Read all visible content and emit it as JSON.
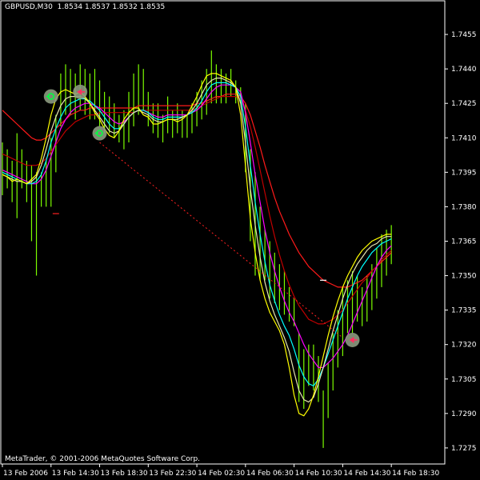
{
  "header": {
    "symbol": "GBPUSD,M30",
    "quote": "1.8534 1.8537 1.8532 1.8535"
  },
  "footer": {
    "copyright": "MetaTrader, © 2001-2006 MetaQuotes Software Corp."
  },
  "chart_data": {
    "type": "line",
    "title": "",
    "background": "#000000",
    "grid": false,
    "ylim": [
      1.7268,
      1.747
    ],
    "xlim": [
      0,
      91
    ],
    "y_ticks": [
      "1.7455",
      "1.7440",
      "1.7425",
      "1.7410",
      "1.7395",
      "1.7380",
      "1.7365",
      "1.7350",
      "1.7335",
      "1.7320",
      "1.7305",
      "1.7290",
      "1.7275"
    ],
    "x_ticks": [
      {
        "label": "13 Feb 2006",
        "index": 0
      },
      {
        "label": "13 Feb 14:30",
        "index": 10
      },
      {
        "label": "13 Feb 18:30",
        "index": 20
      },
      {
        "label": "13 Feb 22:30",
        "index": 30
      },
      {
        "label": "14 Feb 02:30",
        "index": 40
      },
      {
        "label": "14 Feb 06:30",
        "index": 50
      },
      {
        "label": "14 Feb 10:30",
        "index": 60
      },
      {
        "label": "14 Feb 14:30",
        "index": 70
      },
      {
        "label": "14 Feb 18:30",
        "index": 80
      }
    ],
    "bars": {
      "color": "#7CFC00",
      "items": [
        [
          1.7408,
          1.7385
        ],
        [
          1.7405,
          1.7388
        ],
        [
          1.74,
          1.7382
        ],
        [
          1.7412,
          1.7375
        ],
        [
          1.7405,
          1.7388
        ],
        [
          1.74,
          1.7382
        ],
        [
          1.7398,
          1.7365
        ],
        [
          1.7395,
          1.735
        ],
        [
          1.7395,
          1.738
        ],
        [
          1.74,
          1.738
        ],
        [
          1.741,
          1.738
        ],
        [
          1.742,
          1.7395
        ],
        [
          1.7438,
          1.7415
        ],
        [
          1.7442,
          1.742
        ],
        [
          1.744,
          1.742
        ],
        [
          1.7438,
          1.7418
        ],
        [
          1.7442,
          1.7422
        ],
        [
          1.744,
          1.742
        ],
        [
          1.7438,
          1.7418
        ],
        [
          1.744,
          1.7418
        ],
        [
          1.7435,
          1.7415
        ],
        [
          1.743,
          1.7412
        ],
        [
          1.7428,
          1.7412
        ],
        [
          1.7425,
          1.741
        ],
        [
          1.742,
          1.7408
        ],
        [
          1.7422,
          1.7405
        ],
        [
          1.743,
          1.7408
        ],
        [
          1.7438,
          1.7415
        ],
        [
          1.7442,
          1.742
        ],
        [
          1.744,
          1.7422
        ],
        [
          1.743,
          1.7415
        ],
        [
          1.7425,
          1.7412
        ],
        [
          1.7425,
          1.741
        ],
        [
          1.742,
          1.7408
        ],
        [
          1.7428,
          1.7412
        ],
        [
          1.7422,
          1.741
        ],
        [
          1.7425,
          1.7412
        ],
        [
          1.7422,
          1.741
        ],
        [
          1.742,
          1.741
        ],
        [
          1.7425,
          1.7412
        ],
        [
          1.743,
          1.7415
        ],
        [
          1.7435,
          1.7418
        ],
        [
          1.744,
          1.742
        ],
        [
          1.7448,
          1.7425
        ],
        [
          1.7442,
          1.7425
        ],
        [
          1.744,
          1.7425
        ],
        [
          1.7438,
          1.7425
        ],
        [
          1.744,
          1.7428
        ],
        [
          1.7435,
          1.7425
        ],
        [
          1.7432,
          1.7425
        ],
        [
          1.7425,
          1.7395
        ],
        [
          1.7405,
          1.7365
        ],
        [
          1.7395,
          1.735
        ],
        [
          1.738,
          1.7348
        ],
        [
          1.737,
          1.7348
        ],
        [
          1.7365,
          1.734
        ],
        [
          1.736,
          1.7338
        ],
        [
          1.7355,
          1.7335
        ],
        [
          1.7352,
          1.7333
        ],
        [
          1.7345,
          1.733
        ],
        [
          1.734,
          1.7328
        ],
        [
          1.7325,
          1.7295
        ],
        [
          1.7318,
          1.7292
        ],
        [
          1.732,
          1.7302
        ],
        [
          1.732,
          1.73
        ],
        [
          1.7315,
          1.7295
        ],
        [
          1.73,
          1.7275
        ],
        [
          1.7312,
          1.7288
        ],
        [
          1.7325,
          1.73
        ],
        [
          1.7335,
          1.731
        ],
        [
          1.7345,
          1.7315
        ],
        [
          1.7348,
          1.7325
        ],
        [
          1.7352,
          1.7325
        ],
        [
          1.735,
          1.733
        ],
        [
          1.7345,
          1.7328
        ],
        [
          1.735,
          1.733
        ],
        [
          1.7355,
          1.7335
        ],
        [
          1.7362,
          1.734
        ],
        [
          1.7368,
          1.7345
        ],
        [
          1.737,
          1.735
        ],
        [
          1.7372,
          1.7355
        ]
      ]
    },
    "series": [
      {
        "color": "#ff1a1a",
        "values": [
          1.7422,
          1.742,
          1.7418,
          1.7416,
          1.7414,
          1.7412,
          1.741,
          1.7409,
          1.7409,
          1.741,
          1.7412,
          1.7414,
          1.7416,
          1.7418,
          1.742,
          1.7421,
          1.7422,
          1.7422,
          1.7423,
          1.7423,
          1.7423,
          1.7423,
          1.7423,
          1.7423,
          1.7423,
          1.7423,
          1.7423,
          1.7423,
          1.7424,
          1.7424,
          1.7424,
          1.7424,
          1.7424,
          1.7424,
          1.7424,
          1.7424,
          1.7424,
          1.7424,
          1.7424,
          1.7424,
          1.7425,
          1.7425,
          1.7426,
          1.7427,
          1.7428,
          1.7428,
          1.7429,
          1.7429,
          1.7429,
          1.7428,
          1.7425,
          1.742,
          1.7413,
          1.7406,
          1.7398,
          1.7391,
          1.7384,
          1.7378,
          1.7373,
          1.7368,
          1.7364,
          1.736,
          1.7357,
          1.7354,
          1.7352,
          1.735,
          1.7348,
          1.7347,
          1.7346,
          1.7345,
          1.7345,
          1.7345,
          1.7346,
          1.7347,
          1.7348,
          1.735,
          1.7352,
          1.7354,
          1.7356,
          1.7358,
          1.736
        ]
      },
      {
        "color": "#c00000",
        "values": [
          1.7403,
          1.7402,
          1.7401,
          1.74,
          1.7399,
          1.7398,
          1.7398,
          1.7398,
          1.7399,
          1.7401,
          1.7404,
          1.7407,
          1.741,
          1.7413,
          1.7415,
          1.7417,
          1.7418,
          1.7419,
          1.742,
          1.742,
          1.7421,
          1.7421,
          1.7421,
          1.7421,
          1.7421,
          1.7421,
          1.7421,
          1.7421,
          1.7422,
          1.7422,
          1.7422,
          1.7422,
          1.7422,
          1.7422,
          1.7422,
          1.7422,
          1.7422,
          1.7422,
          1.7422,
          1.7422,
          1.7423,
          1.7424,
          1.7425,
          1.7426,
          1.7427,
          1.7428,
          1.7428,
          1.7428,
          1.7428,
          1.7427,
          1.7422,
          1.7415,
          1.7406,
          1.7396,
          1.7386,
          1.7376,
          1.7367,
          1.7359,
          1.7352,
          1.7346,
          1.7341,
          1.7337,
          1.7334,
          1.7331,
          1.733,
          1.7329,
          1.7329,
          1.733,
          1.7331,
          1.7333,
          1.7335,
          1.7338,
          1.7341,
          1.7344,
          1.7347,
          1.7349,
          1.7352,
          1.7354,
          1.7357,
          1.7359,
          1.7361
        ]
      },
      {
        "color": "#ff00ff",
        "values": [
          1.7396,
          1.7395,
          1.7394,
          1.7393,
          1.7392,
          1.7391,
          1.739,
          1.739,
          1.7392,
          1.7396,
          1.7402,
          1.7408,
          1.7414,
          1.7418,
          1.7421,
          1.7423,
          1.7424,
          1.7425,
          1.7425,
          1.7424,
          1.7423,
          1.7421,
          1.7419,
          1.7417,
          1.7416,
          1.7417,
          1.7419,
          1.7421,
          1.7422,
          1.7422,
          1.7421,
          1.742,
          1.7419,
          1.7419,
          1.742,
          1.742,
          1.742,
          1.742,
          1.742,
          1.7421,
          1.7422,
          1.7424,
          1.7427,
          1.743,
          1.7432,
          1.7433,
          1.7433,
          1.7433,
          1.7432,
          1.743,
          1.7421,
          1.7408,
          1.7394,
          1.7382,
          1.737,
          1.736,
          1.7352,
          1.7345,
          1.7339,
          1.7334,
          1.733,
          1.7325,
          1.732,
          1.7316,
          1.7313,
          1.731,
          1.731,
          1.7312,
          1.7314,
          1.7317,
          1.732,
          1.7324,
          1.7329,
          1.7334,
          1.7339,
          1.7344,
          1.7349,
          1.7354,
          1.7358,
          1.7361,
          1.7363
        ]
      },
      {
        "color": "#00ffff",
        "values": [
          1.7395,
          1.7394,
          1.7393,
          1.7392,
          1.7391,
          1.739,
          1.739,
          1.7391,
          1.7394,
          1.74,
          1.7408,
          1.7414,
          1.7419,
          1.7423,
          1.7425,
          1.7426,
          1.7427,
          1.7427,
          1.7426,
          1.7424,
          1.7422,
          1.7419,
          1.7416,
          1.7414,
          1.7414,
          1.7416,
          1.7419,
          1.7421,
          1.7422,
          1.7422,
          1.7421,
          1.7419,
          1.7418,
          1.7418,
          1.7419,
          1.7419,
          1.7419,
          1.7419,
          1.742,
          1.7421,
          1.7423,
          1.7426,
          1.743,
          1.7433,
          1.7434,
          1.7434,
          1.7434,
          1.7433,
          1.7432,
          1.7428,
          1.7415,
          1.7398,
          1.7382,
          1.7368,
          1.7356,
          1.7346,
          1.7339,
          1.7333,
          1.7328,
          1.7324,
          1.7318,
          1.7311,
          1.7306,
          1.7303,
          1.7302,
          1.7305,
          1.731,
          1.7316,
          1.7322,
          1.7328,
          1.7334,
          1.734,
          1.7345,
          1.735,
          1.7354,
          1.7357,
          1.736,
          1.7362,
          1.7364,
          1.7365,
          1.7366
        ]
      },
      {
        "color": "#e6e6b0",
        "values": [
          1.7394,
          1.7393,
          1.7392,
          1.7391,
          1.7391,
          1.739,
          1.7391,
          1.7393,
          1.7398,
          1.7405,
          1.7413,
          1.7419,
          1.7424,
          1.7427,
          1.7428,
          1.7428,
          1.7428,
          1.7427,
          1.7425,
          1.7422,
          1.7419,
          1.7416,
          1.7413,
          1.7412,
          1.7413,
          1.7416,
          1.7419,
          1.7421,
          1.7422,
          1.7421,
          1.742,
          1.7418,
          1.7417,
          1.7417,
          1.7418,
          1.7418,
          1.7418,
          1.7419,
          1.742,
          1.7422,
          1.7425,
          1.7429,
          1.7433,
          1.7435,
          1.7436,
          1.7436,
          1.7435,
          1.7434,
          1.7432,
          1.7425,
          1.7408,
          1.7388,
          1.7372,
          1.7358,
          1.7347,
          1.7339,
          1.7333,
          1.7328,
          1.7323,
          1.7317,
          1.7308,
          1.73,
          1.7296,
          1.7295,
          1.7297,
          1.7303,
          1.731,
          1.7318,
          1.7326,
          1.7333,
          1.734,
          1.7346,
          1.7351,
          1.7355,
          1.7358,
          1.7361,
          1.7363,
          1.7364,
          1.7366,
          1.7367,
          1.7367
        ]
      },
      {
        "color": "#ffff00",
        "values": [
          1.7394,
          1.7393,
          1.7391,
          1.7392,
          1.7391,
          1.739,
          1.7392,
          1.7394,
          1.7401,
          1.741,
          1.742,
          1.7427,
          1.743,
          1.7431,
          1.743,
          1.7429,
          1.743,
          1.7428,
          1.7425,
          1.7421,
          1.7418,
          1.7414,
          1.7411,
          1.741,
          1.7413,
          1.7418,
          1.7421,
          1.7423,
          1.7423,
          1.742,
          1.7419,
          1.7416,
          1.7416,
          1.7417,
          1.7418,
          1.7418,
          1.7417,
          1.7418,
          1.742,
          1.7424,
          1.7428,
          1.7433,
          1.7437,
          1.7438,
          1.7438,
          1.7437,
          1.7436,
          1.7435,
          1.7432,
          1.742,
          1.7398,
          1.7375,
          1.736,
          1.7348,
          1.734,
          1.7334,
          1.733,
          1.7326,
          1.732,
          1.731,
          1.7298,
          1.729,
          1.7289,
          1.7292,
          1.7298,
          1.7306,
          1.7315,
          1.7324,
          1.7332,
          1.7339,
          1.7345,
          1.735,
          1.7354,
          1.7358,
          1.7361,
          1.7363,
          1.7365,
          1.7366,
          1.7367,
          1.7368,
          1.7368
        ]
      }
    ],
    "trendline": {
      "color": "#ff2020",
      "from": [
        20,
        1.7408
      ],
      "to": [
        70,
        1.7323
      ]
    },
    "signals": [
      {
        "kind": "up",
        "index": 10,
        "price": 1.7428
      },
      {
        "kind": "down",
        "index": 16,
        "price": 1.743
      },
      {
        "kind": "up",
        "index": 20,
        "price": 1.7412
      },
      {
        "kind": "down",
        "index": 72,
        "price": 1.7322
      }
    ],
    "ticks_small": [
      {
        "color": "#ff2020",
        "index": 11,
        "price": 1.7377
      },
      {
        "color": "#ffffff",
        "index": 66,
        "price": 1.7348
      }
    ]
  }
}
